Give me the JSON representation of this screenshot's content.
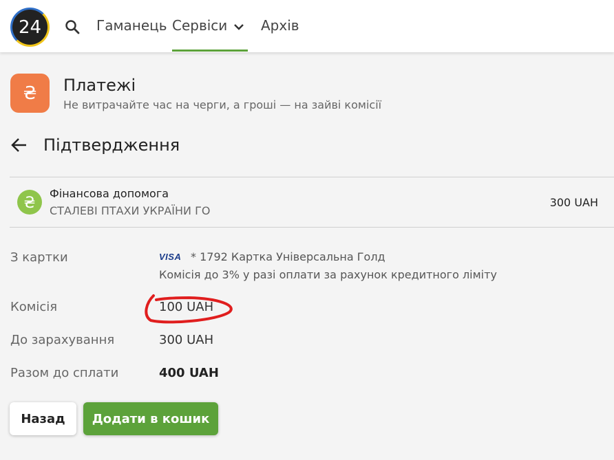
{
  "nav": {
    "logo_text": "24",
    "items": [
      {
        "label": "Гаманець"
      },
      {
        "label": "Сервіси"
      },
      {
        "label": "Архів"
      }
    ],
    "active_color": "#5ca23a"
  },
  "service": {
    "icon_symbol": "₴",
    "icon_color": "#f07c47",
    "title": "Платежі",
    "subtitle": "Не витрачайте час на черги, а гроші — на зайві комісії"
  },
  "confirmation": {
    "title": "Підтвердження"
  },
  "recipient": {
    "icon_symbol": "₴",
    "icon_color": "#8fc54b",
    "name": "Фінансова допомога",
    "organization": "СТАЛЕВІ ПТАХИ УКРАЇНИ ГО",
    "amount": "300 UAH"
  },
  "details": {
    "from_card_label": "З картки",
    "card_brand": "VISA",
    "card_info": "* 1792 Картка Універсальна Голд",
    "card_note": "Комісія до 3% у разі оплати за рахунок кредитного ліміту",
    "commission_label": "Комісія",
    "commission_value": "100 UAH",
    "credited_label": "До зарахування",
    "credited_value": "300 UAH",
    "total_label": "Разом до сплати",
    "total_value": "400 UAH"
  },
  "buttons": {
    "back_label": "Назад",
    "add_to_cart_label": "Додати в кошик"
  }
}
